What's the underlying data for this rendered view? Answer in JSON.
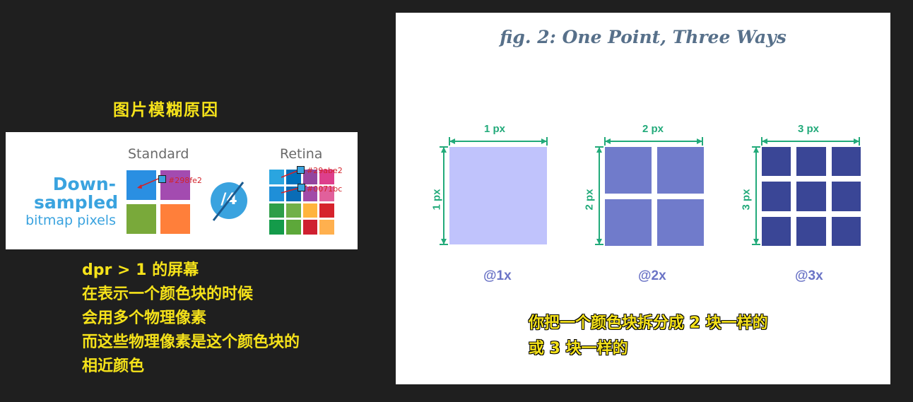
{
  "left_panel": {
    "heading": "图片模糊原因",
    "card": {
      "down_label": "Down-",
      "sampled_label": "sampled",
      "bitmap_label": "bitmap pixels",
      "standard_label": "Standard",
      "retina_label": "Retina",
      "divide_label": "/4",
      "hex_standard": "#298fe2",
      "hex_retina_1": "#29abe2",
      "hex_retina_2": "#0071bc",
      "standard_colors": [
        "#2a8fe2",
        "#a34bb0",
        "#79a93a",
        "#ff7f3a"
      ],
      "retina_colors": [
        "#2aa5e0",
        "#0071bc",
        "#93459f",
        "#dd3f8c",
        "#1f8fd8",
        "#0a6cb6",
        "#a14aa8",
        "#e1609b",
        "#2e9e48",
        "#71b048",
        "#ffb43d",
        "#d6232c",
        "#149b4a",
        "#5da83a",
        "#cf2030",
        "#ffb04e"
      ]
    },
    "notes": [
      "dpr > 1 的屏幕",
      "在表示一个颜色块的时候",
      "会用多个物理像素",
      "而这些物理像素是这个颜色块的",
      "相近颜色"
    ]
  },
  "figure": {
    "title": "fig. 2: One Point, Three Ways",
    "panels": [
      {
        "top": "1 px",
        "side": "1 px",
        "label": "@1x",
        "color": "#c0c3fc"
      },
      {
        "top": "2 px",
        "side": "2 px",
        "label": "@2x",
        "color": "#707bcb"
      },
      {
        "top": "3 px",
        "side": "3 px",
        "label": "@3x",
        "color": "#3a4696"
      }
    ],
    "accent_color": "#22aa7a"
  },
  "caption": [
    "你把一个颜色块拆分成 2 块一样的",
    "或 3 块一样的"
  ]
}
